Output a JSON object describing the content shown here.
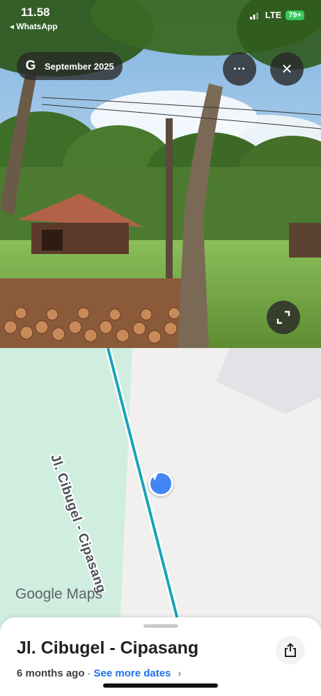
{
  "status_bar": {
    "time": "11.58",
    "back_app": "◂ WhatsApp",
    "network": "LTE",
    "battery": "79+"
  },
  "street_view": {
    "date_label": "September 2025",
    "more_label": "···",
    "close_label": "✕"
  },
  "map": {
    "road_name": "Jl. Cibugel - Cipasang",
    "logo_text": "Google Maps",
    "colors": {
      "park": "#cfeee0",
      "road_line": "#1aa5b7",
      "marker": "#4285f4"
    }
  },
  "sheet": {
    "title": "Jl. Cibugel - Cipasang",
    "age": "6 months ago",
    "separator": "·",
    "see_more": "See more dates",
    "chevron": "›"
  }
}
